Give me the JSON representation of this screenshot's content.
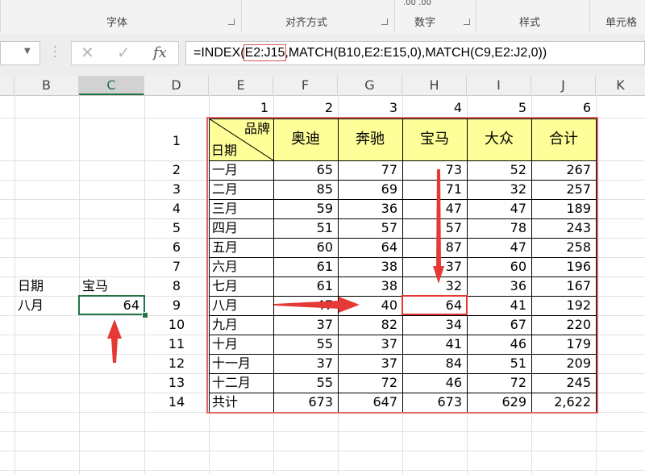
{
  "ribbon": {
    "groups": [
      "字体",
      "对齐方式",
      "数字",
      "样式",
      "单元格"
    ],
    "number_top_text": ".00  .00"
  },
  "formula_bar": {
    "name_box": "",
    "cancel_glyph": "✕",
    "enter_glyph": "✓",
    "fx_label": "fx",
    "formula_before": "=INDEX(",
    "formula_highlight": "E2:J15",
    "formula_after": ",MATCH(B10,E2:E15,0),MATCH(C9,E2:J2,0))"
  },
  "columns": [
    "B",
    "C",
    "D",
    "E",
    "F",
    "G",
    "H",
    "I",
    "J",
    "K"
  ],
  "selected_column": "C",
  "lookup": {
    "b_label": "日期",
    "c_label": "宝马",
    "b_value": "八月",
    "c_value": "64"
  },
  "table": {
    "index_numbers": [
      "1",
      "2",
      "3",
      "4",
      "5",
      "6"
    ],
    "header_brand": "品牌",
    "header_date": "日期",
    "headers": [
      "奥迪",
      "奔驰",
      "宝马",
      "大众",
      "合计"
    ],
    "row_numbers": [
      "1",
      "2",
      "3",
      "4",
      "5",
      "6",
      "7",
      "8",
      "9",
      "10",
      "11",
      "12",
      "13",
      "14"
    ],
    "rows": [
      [
        "一月",
        "65",
        "77",
        "73",
        "52",
        "267"
      ],
      [
        "二月",
        "85",
        "69",
        "71",
        "32",
        "257"
      ],
      [
        "三月",
        "59",
        "36",
        "47",
        "47",
        "189"
      ],
      [
        "四月",
        "51",
        "57",
        "57",
        "78",
        "243"
      ],
      [
        "五月",
        "60",
        "64",
        "87",
        "47",
        "258"
      ],
      [
        "六月",
        "61",
        "38",
        "37",
        "60",
        "196"
      ],
      [
        "七月",
        "61",
        "38",
        "32",
        "36",
        "167"
      ],
      [
        "八月",
        "47",
        "40",
        "64",
        "41",
        "192"
      ],
      [
        "九月",
        "37",
        "82",
        "34",
        "67",
        "220"
      ],
      [
        "十月",
        "55",
        "37",
        "41",
        "46",
        "179"
      ],
      [
        "十一月",
        "37",
        "37",
        "84",
        "51",
        "209"
      ],
      [
        "十二月",
        "55",
        "72",
        "46",
        "72",
        "245"
      ],
      [
        "共计",
        "673",
        "647",
        "673",
        "629",
        "2,622"
      ]
    ]
  },
  "colors": {
    "header_fill": "#ffff99",
    "highlight_red": "#e53935",
    "selection_green": "#217346"
  }
}
